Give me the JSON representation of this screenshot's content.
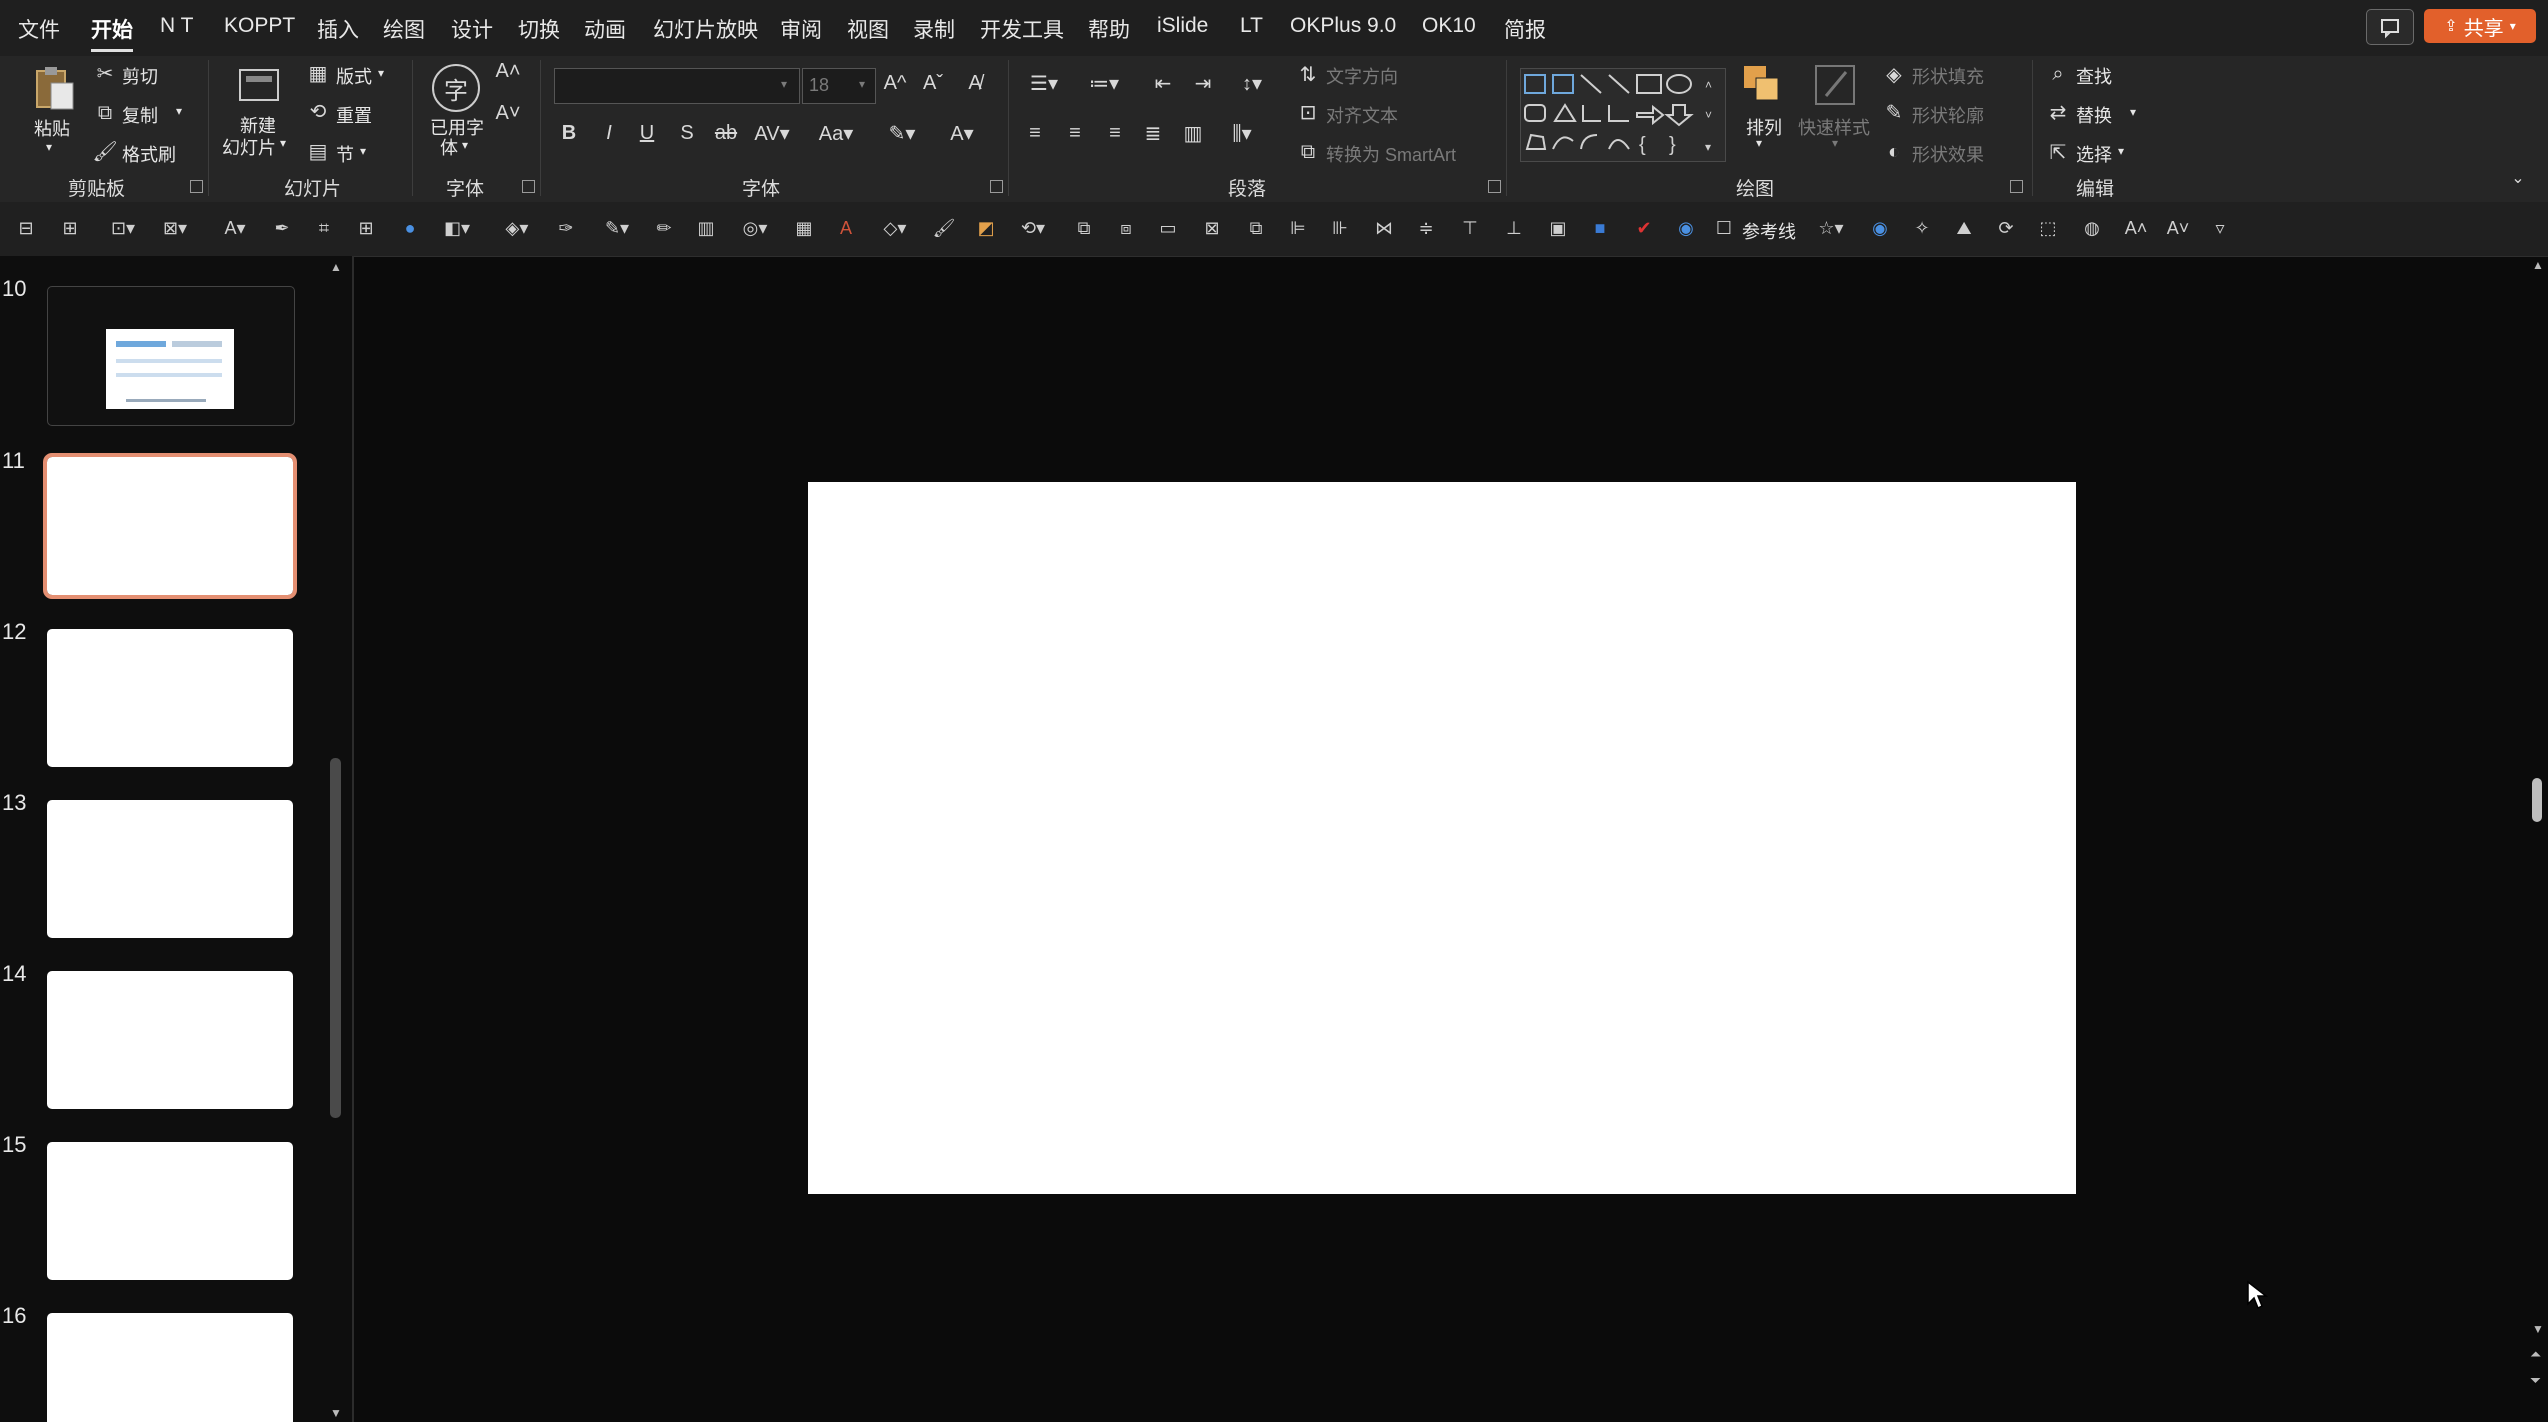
{
  "menu": {
    "tabs": [
      "文件",
      "开始",
      "N T",
      "KOPPT",
      "插入",
      "绘图",
      "设计",
      "切换",
      "动画",
      "幻灯片放映",
      "审阅",
      "视图",
      "录制",
      "开发工具",
      "帮助",
      "iSlide",
      "LT",
      "OKPlus 9.0",
      "OK10",
      "简报"
    ],
    "active_tab": "开始",
    "share_label": "共享"
  },
  "ribbon": {
    "clipboard": {
      "paste": "粘贴",
      "cut": "剪切",
      "copy": "复制",
      "format_painter": "格式刷",
      "group": "剪贴板"
    },
    "slides": {
      "new_slide_line1": "新建",
      "new_slide_line2": "幻灯片",
      "layout": "版式",
      "reset": "重置",
      "section": "节",
      "group": "幻灯片"
    },
    "used_font": {
      "line1": "已用字",
      "line2": "体",
      "group": "字体"
    },
    "font": {
      "font_name": "",
      "font_size": "18",
      "group": "字体"
    },
    "paragraph": {
      "text_direction": "文字方向",
      "align_text": "对齐文本",
      "convert_smartart": "转换为 SmartArt",
      "group": "段落"
    },
    "drawing": {
      "arrange": "排列",
      "quick_styles": "快速样式",
      "shape_fill": "形状填充",
      "shape_outline": "形状轮廓",
      "shape_effects": "形状效果",
      "group": "绘图"
    },
    "editing": {
      "find": "查找",
      "replace": "替换",
      "select": "选择",
      "group": "编辑"
    }
  },
  "quickbar": {
    "guides_label": "参考线"
  },
  "slides_panel": {
    "numbers": [
      "10",
      "11",
      "12",
      "13",
      "14",
      "15",
      "16"
    ],
    "selected": "11"
  },
  "colors": {
    "accent": "#e2602b",
    "selected_thumb": "#e48f72",
    "background": "#0b0b0b"
  }
}
